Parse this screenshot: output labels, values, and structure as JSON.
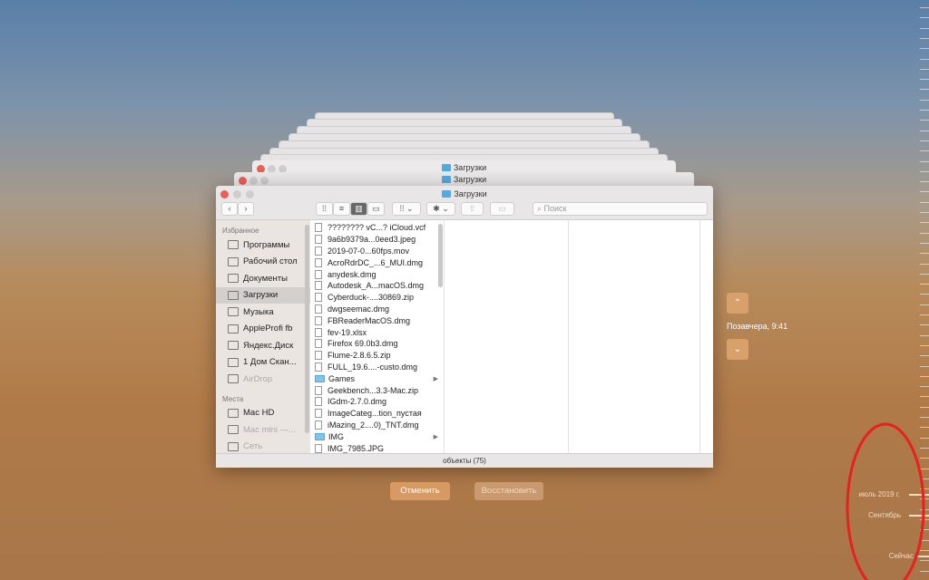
{
  "window": {
    "title": "Загрузки",
    "status": "объекты (75)",
    "search_placeholder": "Поиск"
  },
  "sidebar": {
    "favorites_header": "Избранное",
    "favorites": [
      {
        "label": "Программы",
        "icon": "apps-icon"
      },
      {
        "label": "Рабочий стол",
        "icon": "desktop-icon"
      },
      {
        "label": "Документы",
        "icon": "documents-icon"
      },
      {
        "label": "Загрузки",
        "icon": "downloads-icon",
        "selected": true
      },
      {
        "label": "Музыка",
        "icon": "music-icon"
      },
      {
        "label": "AppleProfi fb",
        "icon": "folder-icon"
      },
      {
        "label": "Яндекс.Диск",
        "icon": "folder-icon"
      },
      {
        "label": "1 Дом Скан...",
        "icon": "folder-icon"
      },
      {
        "label": "AirDrop",
        "icon": "airdrop-icon",
        "dim": true
      }
    ],
    "places_header": "Места",
    "places": [
      {
        "label": "Mac HD",
        "icon": "disk-icon"
      },
      {
        "label": "Mac mini —...",
        "icon": "computer-icon",
        "dim": true
      },
      {
        "label": "Сеть",
        "icon": "network-icon",
        "dim": true
      }
    ]
  },
  "files": [
    {
      "name": "???????? vC...? iCloud.vcf"
    },
    {
      "name": "9a6b9379a...0eed3.jpeg"
    },
    {
      "name": "2019-07-0...60fps.mov"
    },
    {
      "name": "AcroRdrDC_...6_MUI.dmg"
    },
    {
      "name": "anydesk.dmg"
    },
    {
      "name": "Autodesk_A...macOS.dmg"
    },
    {
      "name": "Cyberduck-....30869.zip"
    },
    {
      "name": "dwgseemac.dmg"
    },
    {
      "name": "FBReaderMacOS.dmg"
    },
    {
      "name": "fev-19.xlsx"
    },
    {
      "name": "Firefox 69.0b3.dmg"
    },
    {
      "name": "Flume-2.8.6.5.zip"
    },
    {
      "name": "FULL_19.6....-custo.dmg"
    },
    {
      "name": "Games",
      "folder": true
    },
    {
      "name": "Geekbench...3.3-Mac.zip"
    },
    {
      "name": "IGdm-2.7.0.dmg"
    },
    {
      "name": "ImageCateg...tion_пустая"
    },
    {
      "name": "iMazing_2....0)_TNT.dmg"
    },
    {
      "name": "IMG",
      "folder": true
    },
    {
      "name": "IMG_7985.JPG"
    }
  ],
  "timemachine": {
    "cancel": "Отменить",
    "restore": "Восстановить",
    "snapshot_date": "Позавчера, 9:41",
    "timeline": [
      "июль 2019 г.",
      "Сентябрь",
      "Сейчас"
    ]
  }
}
